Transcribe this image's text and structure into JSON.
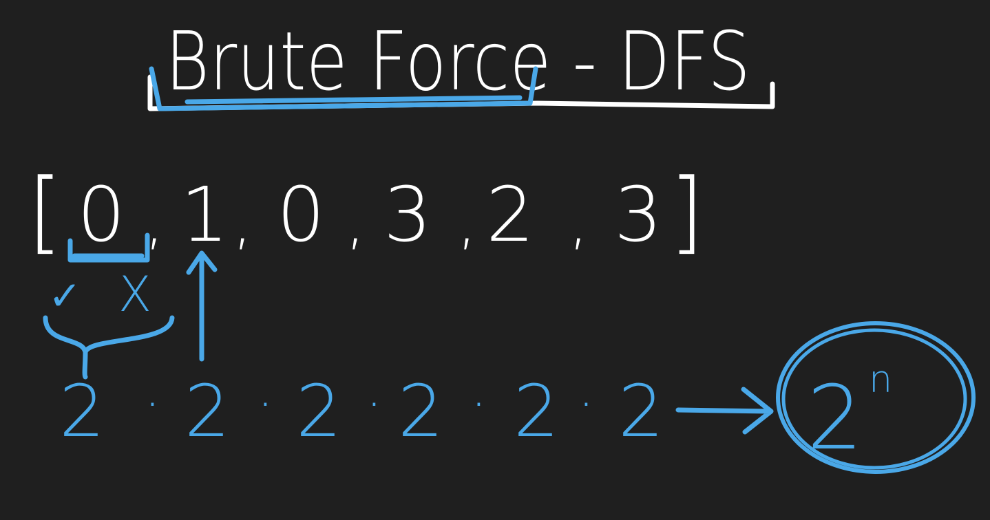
{
  "colors": {
    "background": "#1f1f1f",
    "ink_white": "#ffffff",
    "ink_blue": "#4aa8e8"
  },
  "title": {
    "text": "Brute Force - DFS"
  },
  "array": {
    "open_bracket": "[",
    "close_bracket": "]",
    "values": [
      "0",
      "1",
      "0",
      "3",
      "2",
      "3"
    ],
    "separator": ","
  },
  "choices": {
    "include_symbol": "✓",
    "exclude_symbol": "X"
  },
  "product": {
    "factors": [
      "2",
      "2",
      "2",
      "2",
      "2",
      "2"
    ],
    "dot": "·",
    "result_base": "2",
    "result_exponent": "n"
  }
}
